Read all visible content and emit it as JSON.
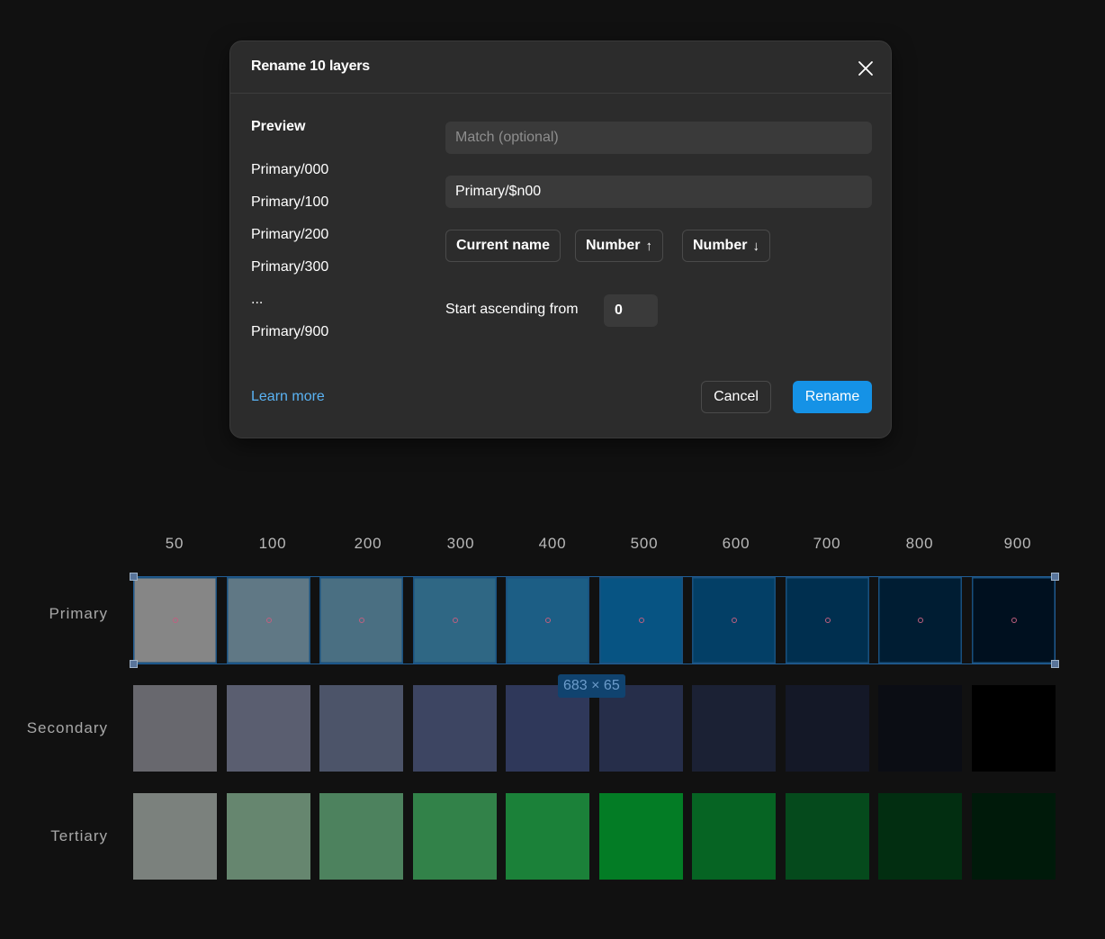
{
  "dialog": {
    "title": "Rename 10 layers",
    "preview_title": "Preview",
    "preview_items": [
      "Primary/000",
      "Primary/100",
      "Primary/200",
      "Primary/300",
      "...",
      "Primary/900"
    ],
    "match_placeholder": "Match (optional)",
    "match_value": "",
    "pattern_value": "Primary/$n00",
    "chips": {
      "current_name": "Current name",
      "number_asc": "Number",
      "number_asc_arrow": "↑",
      "number_desc": "Number",
      "number_desc_arrow": "↓"
    },
    "ascending_label": "Start ascending from",
    "ascending_value": "0",
    "learn_more": "Learn more",
    "cancel": "Cancel",
    "rename": "Rename",
    "accent_color": "#1592e6"
  },
  "palette": {
    "columns": [
      "50",
      "100",
      "200",
      "300",
      "400",
      "500",
      "600",
      "700",
      "800",
      "900"
    ],
    "rows": [
      {
        "label": "Primary",
        "selected": true,
        "colors": [
          "#868686",
          "#607885",
          "#4a6f82",
          "#2f6784",
          "#1c5e85",
          "#075483",
          "#033f66",
          "#002f4f",
          "#001d33",
          "#00101f"
        ]
      },
      {
        "label": "Secondary",
        "selected": false,
        "colors": [
          "#68686e",
          "#5a5e70",
          "#4c5469",
          "#3d4562",
          "#2f385a",
          "#262e4a",
          "#1b2134",
          "#141827",
          "#0b0d14",
          "#000000"
        ]
      },
      {
        "label": "Tertiary",
        "selected": false,
        "colors": [
          "#7b817d",
          "#66866f",
          "#4d825e",
          "#328249",
          "#1b8139",
          "#037c25",
          "#066423",
          "#054a1c",
          "#022e11",
          "#001a0a"
        ]
      }
    ],
    "selection_size": "683 × 65"
  }
}
